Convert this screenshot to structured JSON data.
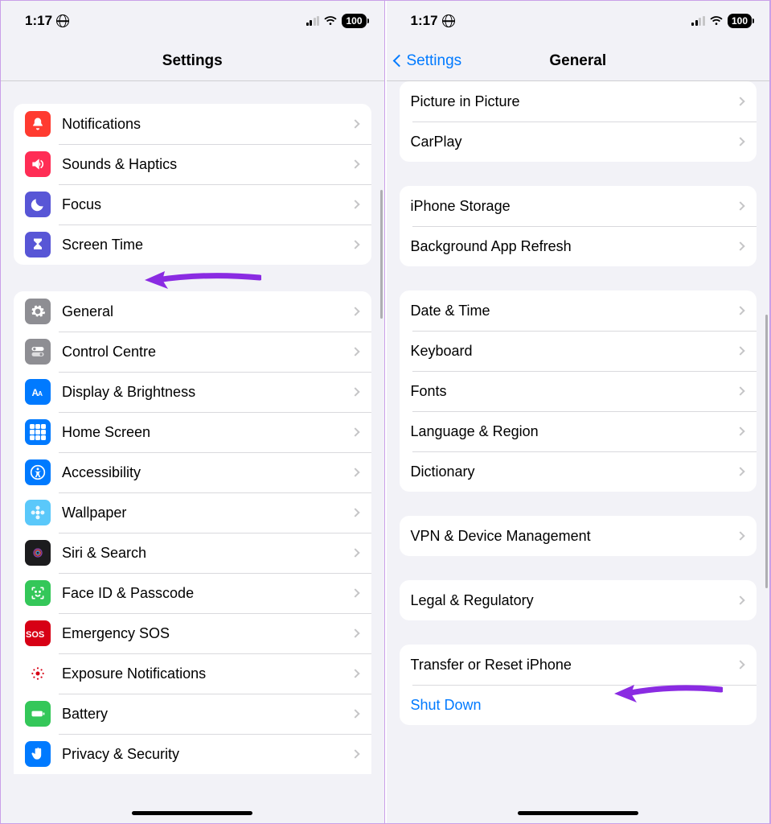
{
  "status": {
    "time": "1:17",
    "battery": "100"
  },
  "left": {
    "title": "Settings",
    "group1": [
      {
        "id": "notifications",
        "label": "Notifications",
        "iconBg": "bg-red",
        "icon": "bell-icon"
      },
      {
        "id": "sounds",
        "label": "Sounds & Haptics",
        "iconBg": "bg-pink",
        "icon": "speaker-icon"
      },
      {
        "id": "focus",
        "label": "Focus",
        "iconBg": "bg-purple",
        "icon": "moon-icon"
      },
      {
        "id": "screentime",
        "label": "Screen Time",
        "iconBg": "bg-purple",
        "icon": "hourglass-icon"
      }
    ],
    "group2": [
      {
        "id": "general",
        "label": "General",
        "iconBg": "bg-gray",
        "icon": "gear-icon"
      },
      {
        "id": "control-centre",
        "label": "Control Centre",
        "iconBg": "bg-gray",
        "icon": "switches-icon"
      },
      {
        "id": "display-brightness",
        "label": "Display & Brightness",
        "iconBg": "bg-blue",
        "icon": "text-size-icon"
      },
      {
        "id": "home-screen",
        "label": "Home Screen",
        "iconBg": "bg-blue",
        "icon": "grid-icon"
      },
      {
        "id": "accessibility",
        "label": "Accessibility",
        "iconBg": "bg-blue",
        "icon": "accessibility-icon"
      },
      {
        "id": "wallpaper",
        "label": "Wallpaper",
        "iconBg": "bg-teal",
        "icon": "flower-icon"
      },
      {
        "id": "siri-search",
        "label": "Siri & Search",
        "iconBg": "bg-dark",
        "icon": "siri-icon"
      },
      {
        "id": "faceid",
        "label": "Face ID & Passcode",
        "iconBg": "bg-green",
        "icon": "faceid-icon"
      },
      {
        "id": "emergency-sos",
        "label": "Emergency SOS",
        "iconBg": "bg-redv",
        "icon": "sos-icon"
      },
      {
        "id": "exposure",
        "label": "Exposure Notifications",
        "iconBg": "",
        "icon": "exposure-icon"
      },
      {
        "id": "battery",
        "label": "Battery",
        "iconBg": "bg-green",
        "icon": "battery-icon"
      },
      {
        "id": "privacy",
        "label": "Privacy & Security",
        "iconBg": "bg-blue",
        "icon": "hand-icon"
      }
    ]
  },
  "right": {
    "back": "Settings",
    "title": "General",
    "group1": [
      {
        "id": "pip",
        "label": "Picture in Picture"
      },
      {
        "id": "carplay",
        "label": "CarPlay"
      }
    ],
    "group2": [
      {
        "id": "storage",
        "label": "iPhone Storage"
      },
      {
        "id": "bg-refresh",
        "label": "Background App Refresh"
      }
    ],
    "group3": [
      {
        "id": "date-time",
        "label": "Date & Time"
      },
      {
        "id": "keyboard",
        "label": "Keyboard"
      },
      {
        "id": "fonts",
        "label": "Fonts"
      },
      {
        "id": "lang-region",
        "label": "Language & Region"
      },
      {
        "id": "dictionary",
        "label": "Dictionary"
      }
    ],
    "group4": [
      {
        "id": "vpn",
        "label": "VPN & Device Management"
      }
    ],
    "group5": [
      {
        "id": "legal",
        "label": "Legal & Regulatory"
      }
    ],
    "group6": [
      {
        "id": "transfer-reset",
        "label": "Transfer or Reset iPhone",
        "chevron": true
      },
      {
        "id": "shutdown",
        "label": "Shut Down",
        "link": true
      }
    ]
  }
}
